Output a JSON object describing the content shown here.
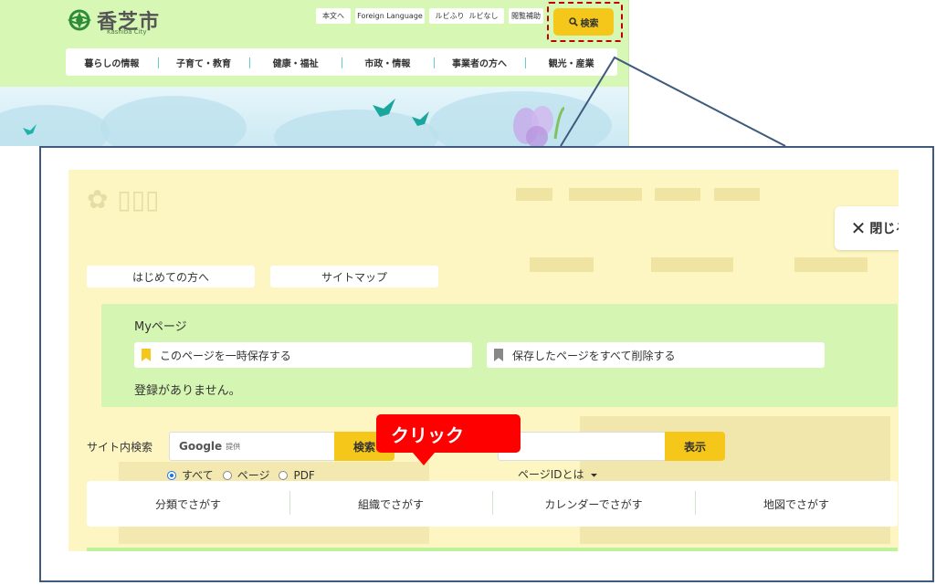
{
  "site": {
    "logo_text": "香芝市",
    "logo_sub": "Kashiba City",
    "util": {
      "honbun": "本文へ",
      "foreign": "Foreign Language",
      "ruby_on": "ルビふり",
      "ruby_off": "ルビなし",
      "reading": "閲覧補助"
    },
    "search_label": "検索",
    "gnav": [
      "暮らしの情報",
      "子育て・教育",
      "健康・福祉",
      "市政・情報",
      "事業者の方へ",
      "観光・産業"
    ]
  },
  "overlay": {
    "close_label": "閉じる",
    "quick_links": [
      "はじめての方へ",
      "サイトマップ"
    ],
    "mypage": {
      "title": "Myページ",
      "save_label": "このページを一時保存する",
      "delete_label": "保存したページをすべて削除する",
      "empty_msg": "登録がありません。"
    },
    "site_search": {
      "label": "サイト内検索",
      "google": "Google",
      "provider": "提供",
      "button": "検索",
      "radios": [
        "すべて",
        "ページ",
        "PDF"
      ],
      "selected": "すべて"
    },
    "page_id": {
      "button": "表示",
      "help": "ページIDとは"
    },
    "callout": "クリック",
    "tabs": [
      "分類でさがす",
      "組織でさがす",
      "カレンダーでさがす",
      "地図でさがす"
    ]
  },
  "colors": {
    "header_bg": "#d7f7b4",
    "accent_yellow": "#f5c71a",
    "highlight_red": "#c00000",
    "callout_red": "#ff0000",
    "overlay_bg": "#fdf6c2",
    "frame": "#3e5a7d"
  }
}
